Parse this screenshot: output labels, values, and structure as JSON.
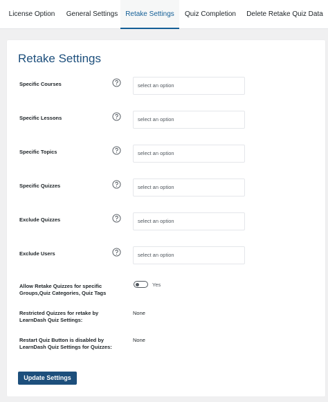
{
  "tabs": [
    {
      "label": "License Option",
      "active": false
    },
    {
      "label": "General Settings",
      "active": false
    },
    {
      "label": "Retake Settings",
      "active": true
    },
    {
      "label": "Quiz Completion",
      "active": false
    },
    {
      "label": "Delete Retake Quiz Data",
      "active": false
    }
  ],
  "panel": {
    "title": "Retake Settings",
    "fields": [
      {
        "label": "Specific Courses",
        "placeholder": "select an option"
      },
      {
        "label": "Specific Lessons",
        "placeholder": "select an option"
      },
      {
        "label": "Specific Topics",
        "placeholder": "select an option"
      },
      {
        "label": "Specific Quizzes",
        "placeholder": "select an option"
      },
      {
        "label": "Exclude Quizzes",
        "placeholder": "select an option"
      },
      {
        "label": "Exclude Users",
        "placeholder": "select an option"
      }
    ],
    "toggle_setting": {
      "label": "Allow Retake Quizzes for specific Groups,Quiz Categories, Quiz Tags",
      "value_label": "Yes"
    },
    "info_rows": [
      {
        "label": "Restricted Quizzes for retake by LearnDash Quiz Settings:",
        "value": "None"
      },
      {
        "label": "Restart Quiz Button is disabled by LearnDash Quiz Settings for Quizzes:",
        "value": "None"
      }
    ],
    "submit_label": "Update Settings"
  },
  "colors": {
    "accent": "#135e96",
    "button": "#1d4f7c",
    "background": "#f0f0f1"
  }
}
